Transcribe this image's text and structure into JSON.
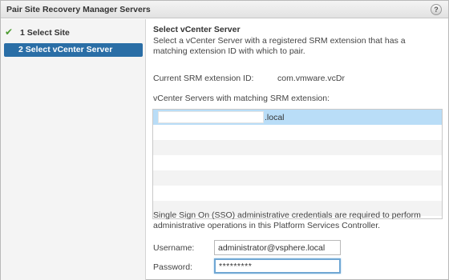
{
  "dialog": {
    "title": "Pair Site Recovery Manager Servers",
    "help_icon": "help-icon",
    "help_glyph": "?"
  },
  "steps": [
    {
      "number": "1",
      "label": "Select Site",
      "state": "completed",
      "icon": "check-icon"
    },
    {
      "number": "2",
      "label": "Select vCenter Server",
      "state": "active"
    }
  ],
  "step_labels": [
    "1  Select Site",
    "2  Select vCenter Server"
  ],
  "main": {
    "section_title": "Select vCenter Server",
    "description": "Select a vCenter Server with a registered SRM extension that has a matching extension ID with which to pair.",
    "extension_label": "Current SRM extension ID:",
    "extension_value": "com.vmware.vcDr",
    "list_label": "vCenter Servers with matching SRM extension:",
    "servers": [
      {
        "name_suffix": ".local",
        "selected": true
      }
    ],
    "sso_text": "Single Sign On (SSO) administrative credentials are required to perform administrative operations in this Platform Services Controller.",
    "username_label": "Username:",
    "username_value": "administrator@vsphere.local",
    "password_label": "Password:",
    "password_value": "*********"
  },
  "colors": {
    "selected_step": "#2a6ea6",
    "selected_row": "#b9ddf7",
    "check": "#4b9b2f",
    "focus_border": "#6fa7d4"
  }
}
